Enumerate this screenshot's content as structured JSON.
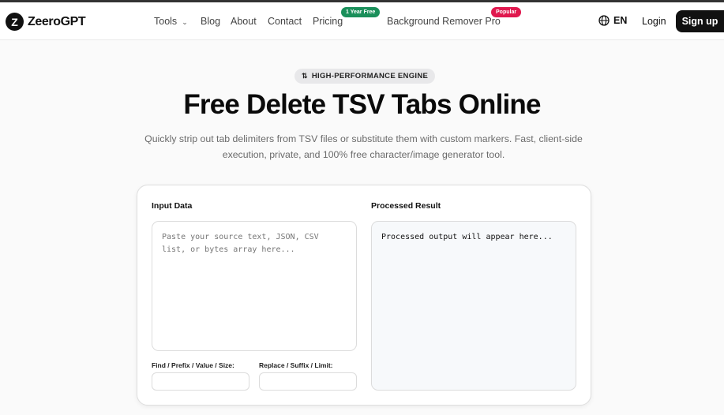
{
  "header": {
    "brand": "ZeeroGPT",
    "nav": {
      "tools": "Tools",
      "blog": "Blog",
      "about": "About",
      "contact": "Contact",
      "pricing": "Pricing",
      "pricing_badge": "1 Year Free",
      "bg_remover": "Background Remover Pro",
      "bg_remover_badge": "Popular"
    },
    "language": "EN",
    "login": "Login",
    "signup": "Sign up"
  },
  "hero": {
    "pill": "HIGH-PERFORMANCE ENGINE",
    "title": "Free Delete TSV Tabs Online",
    "subtitle": "Quickly strip out tab delimiters from TSV files or substitute them with custom markers. Fast, client-side execution, private, and 100% free character/image generator tool."
  },
  "tool": {
    "input_label": "Input Data",
    "input_placeholder": "Paste your source text, JSON, CSV list, or bytes array here...",
    "result_label": "Processed Result",
    "result_text": "Processed output will appear here...",
    "find_label": "Find / Prefix / Value / Size:",
    "replace_label": "Replace / Suffix / Limit:"
  },
  "colors": {
    "accent": "#111111",
    "badge_green": "#1a8f5a",
    "badge_red": "#e0184e"
  }
}
